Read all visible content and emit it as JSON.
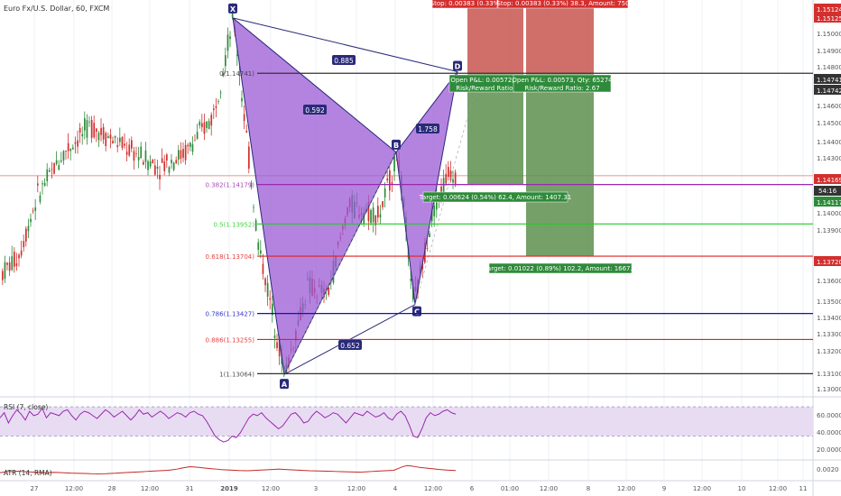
{
  "header": {
    "symbol_title": "Euro Fx/U.S. Dollar, 60, FXCM"
  },
  "colors": {
    "up_candle": "#2e8b3a",
    "down_candle": "#d32f2f",
    "pattern_fill": "#9b59d6",
    "pattern_stroke": "#2a2a7a",
    "profit_zone": "#5d8f4e",
    "loss_zone": "#c8564f",
    "rsi_line": "#9c27b0",
    "atr_line": "#c62828",
    "fib_0": "#333333",
    "fib_382": "#9c27b0",
    "fib_5": "#22cc22",
    "fib_618": "#e02020",
    "fib_786": "#1010c0",
    "fib_886": "#e02020",
    "fib_1": "#333333",
    "current_price_line": "#e57373"
  },
  "chart_data": {
    "type": "candlestick",
    "title": "Euro Fx/U.S. Dollar, 60, FXCM",
    "ylim": [
      1.1295,
      1.1515
    ],
    "y_ticks": [
      "1.15124",
      "1.15125",
      "1.15000",
      "1.14900",
      "1.14800",
      "1.14741",
      "1.14742",
      "1.14600",
      "1.14500",
      "1.14400",
      "1.14300",
      "1.14169",
      "1.14117",
      "1.14000",
      "1.13900",
      "1.13720",
      "1.13600",
      "1.13500",
      "1.13400",
      "1.13300",
      "1.13200",
      "1.13100",
      "1.13000"
    ],
    "x_ticks": [
      "27",
      "12:00",
      "28",
      "12:00",
      "31",
      "2019",
      "12:00",
      "3",
      "12:00",
      "4",
      "12:00",
      "6",
      "01:00",
      "12:00",
      "8",
      "12:00",
      "9",
      "12:00",
      "10",
      "12:00",
      "11"
    ],
    "current_price": "1.14169",
    "countdown": "54:16",
    "harmonic_points": [
      {
        "label": "X",
        "price": 1.1505
      },
      {
        "label": "A",
        "price": 1.1306
      },
      {
        "label": "B",
        "price": 1.143
      },
      {
        "label": "C",
        "price": 1.1345
      },
      {
        "label": "D",
        "price": 1.1475
      }
    ],
    "harmonic_ratios": [
      "0.885",
      "0.592",
      "1.758",
      "0.652"
    ],
    "fib_levels": [
      {
        "label": "0(1.14741)",
        "price": 1.14741,
        "color": "#333333"
      },
      {
        "label": "0.382(1.14179)",
        "price": 1.1412,
        "color": "#9c27b0"
      },
      {
        "label": "0.5(1.13952)",
        "price": 1.139,
        "color": "#22cc22"
      },
      {
        "label": "0.618(1.13704)",
        "price": 1.1372,
        "color": "#e02020"
      },
      {
        "label": "0.786(1.13427)",
        "price": 1.134,
        "color": "#1010c0"
      },
      {
        "label": "0.886(1.13255)",
        "price": 1.13255,
        "color": "#e02020"
      },
      {
        "label": "1(1.13064)",
        "price": 1.13064,
        "color": "#333333"
      }
    ],
    "positions": [
      {
        "stop_label": "Stop: 0.00383 (0.33%",
        "open_label": "Open P&L: 0.00572, C",
        "rr_label": "Risk/Reward Ratio:",
        "target_label": "Target: 0.00624 (0.54%) 62.4, Amount: 1407.31",
        "entry": 1.14742,
        "stop": 1.15125,
        "target": 1.14118
      },
      {
        "stop_label": "Stop: 0.00383 (0.33%) 38.3, Amount: 750",
        "open_label": "Open P&L: 0.00573, Qty: 65274",
        "rr_label": "Risk/Reward Ratio: 2.67",
        "target_label": "Target: 0.01022 (0.89%) 102.2, Amount: 1667.1",
        "entry": 1.14742,
        "stop": 1.15125,
        "target": 1.1372
      }
    ],
    "rsi": {
      "label": "RSI (7, close)",
      "ticks": [
        "60.0000",
        "40.0000",
        "20.0000"
      ],
      "ylim": [
        0,
        80
      ],
      "values": [
        55,
        62,
        48,
        58,
        66,
        60,
        52,
        64,
        58,
        60,
        68,
        55,
        62,
        60,
        58,
        64,
        66,
        58,
        52,
        60,
        64,
        62,
        58,
        54,
        60,
        66,
        62,
        56,
        60,
        64,
        58,
        52,
        58,
        66,
        60,
        62,
        56,
        60,
        64,
        60,
        54,
        58,
        62,
        60,
        56,
        62,
        64,
        60,
        58,
        50,
        40,
        30,
        25,
        22,
        24,
        30,
        28,
        35,
        45,
        55,
        60,
        58,
        62,
        55,
        50,
        45,
        40,
        44,
        52,
        60,
        62,
        56,
        48,
        50,
        58,
        64,
        60,
        55,
        58,
        62,
        60,
        54,
        48,
        55,
        62,
        60,
        58,
        64,
        60,
        56,
        58,
        62,
        55,
        52,
        60,
        64,
        58,
        45,
        30,
        28,
        40,
        55,
        62,
        58,
        60,
        64,
        66,
        62,
        60
      ]
    },
    "atr": {
      "label": "ATR (14, RMA)",
      "ticks": [
        "0.0020"
      ],
      "ylim": [
        0.0008,
        0.0024
      ],
      "values": [
        0.0014,
        0.00145,
        0.0015,
        0.00148,
        0.00152,
        0.0015,
        0.00148,
        0.00146,
        0.00144,
        0.00142,
        0.0014,
        0.00141,
        0.00143,
        0.00142,
        0.0014,
        0.00138,
        0.00136,
        0.00135,
        0.00134,
        0.00133,
        0.00132,
        0.0013,
        0.00129,
        0.0013,
        0.00131,
        0.00133,
        0.00135,
        0.00138,
        0.0014,
        0.00142,
        0.00144,
        0.00146,
        0.00148,
        0.0015,
        0.00152,
        0.00154,
        0.00156,
        0.00158,
        0.0016,
        0.00165,
        0.0017,
        0.00178,
        0.00185,
        0.0019,
        0.00188,
        0.00185,
        0.0018,
        0.00176,
        0.00172,
        0.0017,
        0.00166,
        0.00164,
        0.00162,
        0.0016,
        0.00158,
        0.00157,
        0.00156,
        0.00158,
        0.0016,
        0.00162,
        0.00164,
        0.00166,
        0.00168,
        0.0017,
        0.00168,
        0.00166,
        0.00164,
        0.00162,
        0.0016,
        0.00158,
        0.00156,
        0.00155,
        0.00154,
        0.00153,
        0.00152,
        0.00151,
        0.0015,
        0.00149,
        0.00148,
        0.00147,
        0.00146,
        0.00145,
        0.00146,
        0.00148,
        0.0015,
        0.00152,
        0.00154,
        0.00156,
        0.00158,
        0.0016,
        0.00175,
        0.0019,
        0.002,
        0.00196,
        0.0019,
        0.00184,
        0.0018,
        0.00176,
        0.00172,
        0.00168,
        0.00165,
        0.00162,
        0.0016,
        0.00158
      ]
    }
  }
}
